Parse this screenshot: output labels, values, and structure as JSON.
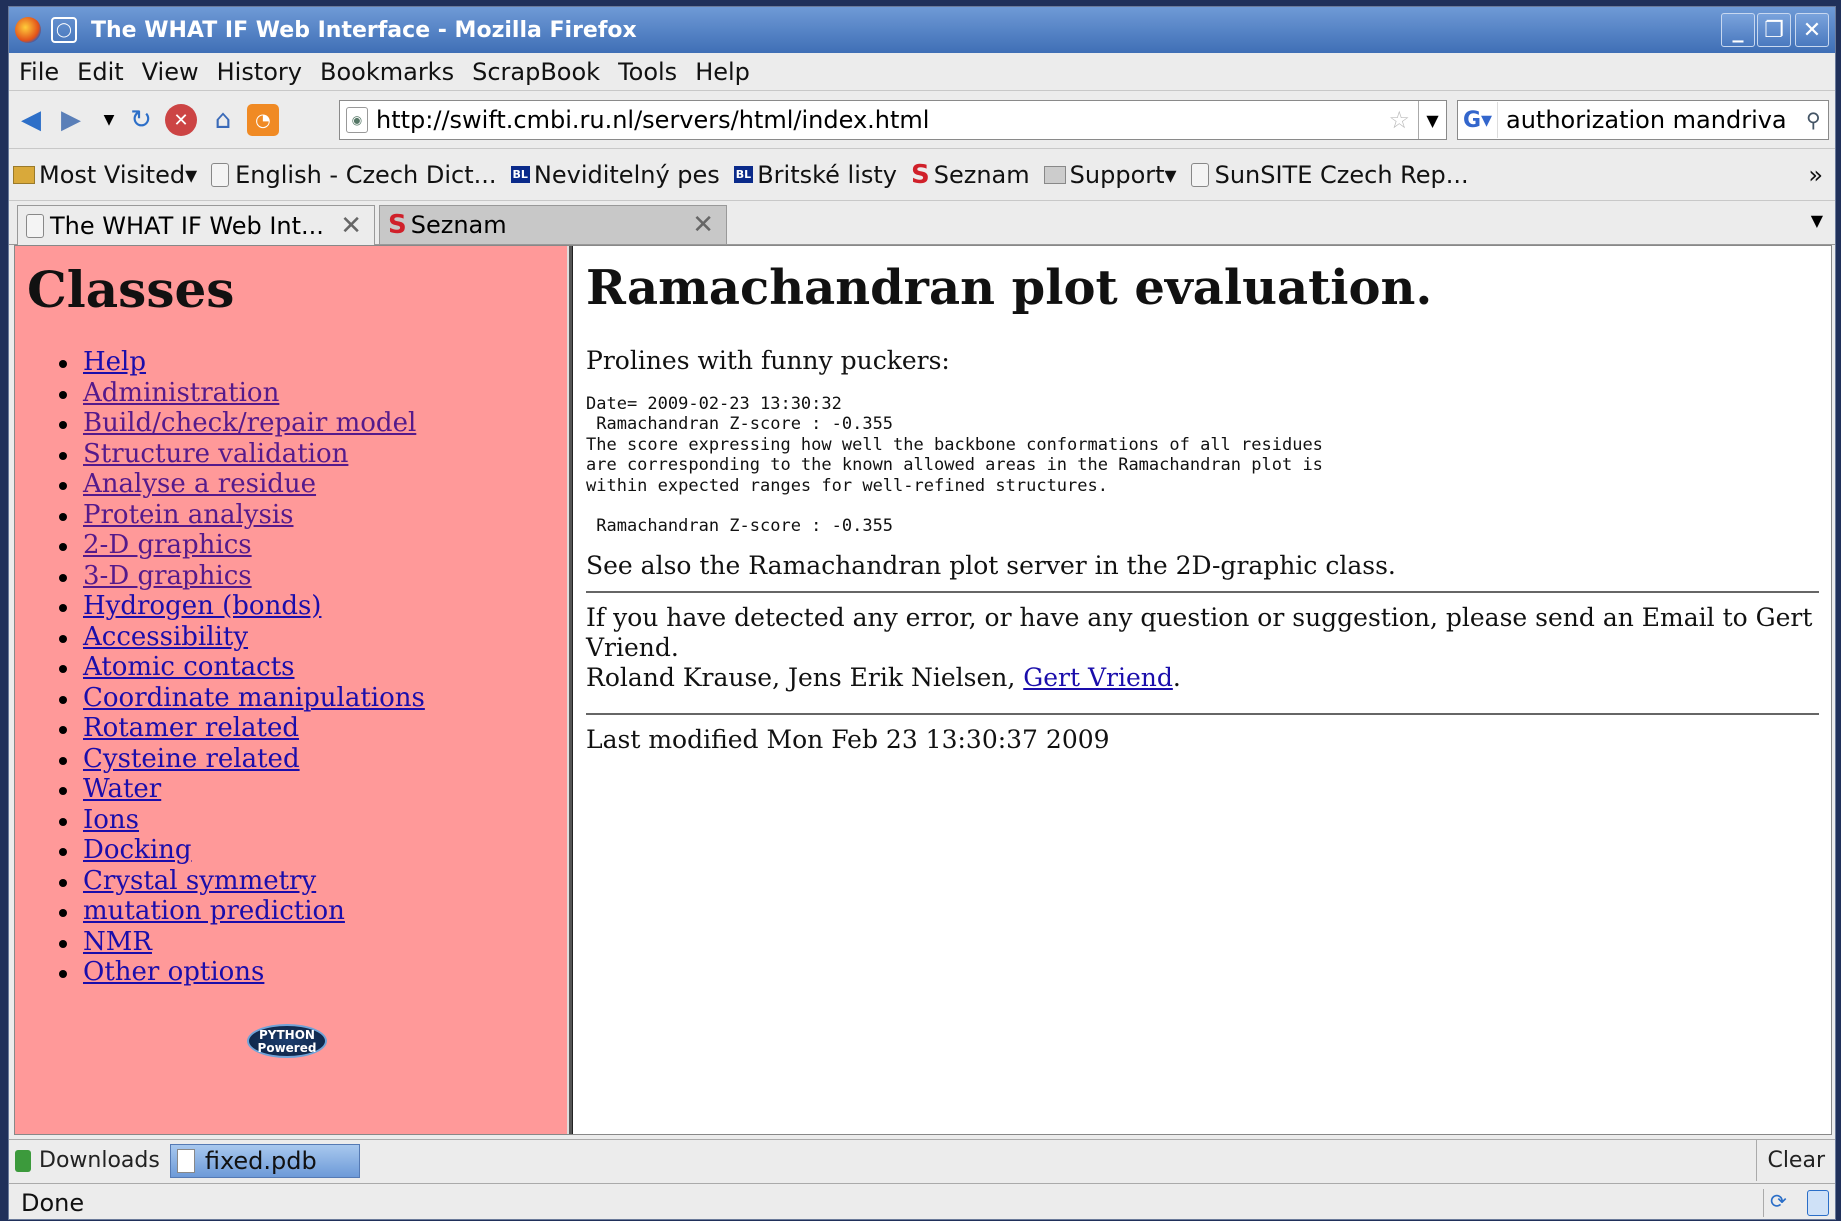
{
  "window": {
    "title": "The WHAT IF Web Interface - Mozilla Firefox"
  },
  "menu": [
    "File",
    "Edit",
    "View",
    "History",
    "Bookmarks",
    "ScrapBook",
    "Tools",
    "Help"
  ],
  "navbar": {
    "url": "http://swift.cmbi.ru.nl/servers/html/index.html",
    "search_value": "authorization mandriva"
  },
  "bookmarks": {
    "most_visited": "Most Visited",
    "english_czech": "English - Czech Dict...",
    "neviditelny": "Neviditelný pes",
    "britske": "Britské listy",
    "seznam": "Seznam",
    "support": "Support",
    "sunsite": "SunSITE Czech Rep...",
    "bl_badge": "BL",
    "overflow": "»"
  },
  "tabs": [
    {
      "label": "The WHAT IF Web Int..."
    },
    {
      "label": "Seznam"
    }
  ],
  "left": {
    "heading": "Classes",
    "items": [
      "Help",
      "Administration",
      "Build/check/repair model",
      "Structure validation",
      "Analyse a residue",
      "Protein analysis",
      "2-D graphics",
      "3-D graphics",
      "Hydrogen (bonds)",
      "Accessibility",
      "Atomic contacts",
      "Coordinate manipulations",
      "Rotamer related",
      "Cysteine related",
      "Water",
      "Ions",
      "Docking",
      "Crystal symmetry",
      "mutation prediction",
      "NMR",
      "Other options"
    ],
    "python_badge": "PYTHON Powered"
  },
  "right": {
    "heading": "Ramachandran plot evaluation.",
    "intro": "Prolines with funny puckers:",
    "pre": "Date= 2009-02-23 13:30:32\n Ramachandran Z-score : -0.355\nThe score expressing how well the backbone conformations of all residues\nare corresponding to the known allowed areas in the Ramachandran plot is\nwithin expected ranges for well-refined structures.\n\n Ramachandran Z-score : -0.355",
    "see_also": "See also the Ramachandran plot server in the 2D-graphic class.",
    "contact": "If you have detected any error, or have any question or suggestion, please send an Email to Gert Vriend.",
    "authors": "Roland Krause, Jens Erik Nielsen,",
    "author_link": "Gert Vriend",
    "author_end": ".",
    "last_modified": "Last modified Mon Feb 23 13:30:37 2009"
  },
  "downloads": {
    "label": "Downloads",
    "file": "fixed.pdb",
    "clear": "Clear"
  },
  "status": {
    "text": "Done"
  }
}
